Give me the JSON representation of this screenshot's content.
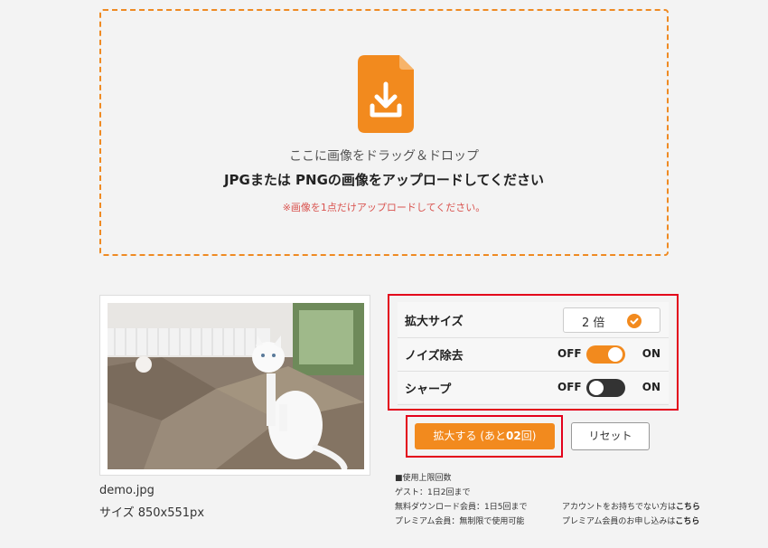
{
  "dropzone": {
    "icon": "download-file-icon",
    "drag_text": "ここに画像をドラッグ＆ドロップ",
    "upload_text": "JPGまたは PNGの画像をアップロードしてください",
    "note": "※画像を1点だけアップロードしてください。"
  },
  "preview": {
    "file_name": "demo.jpg",
    "size_text": "サイズ 850x551px"
  },
  "settings": {
    "enlarge_size": {
      "label": "拡大サイズ",
      "value": "2 倍",
      "icon": "check-circle-icon"
    },
    "noise_reduction": {
      "label": "ノイズ除去",
      "off_label": "OFF",
      "on_label": "ON",
      "state": "on"
    },
    "sharpen": {
      "label": "シャープ",
      "off_label": "OFF",
      "on_label": "ON",
      "state": "off"
    }
  },
  "actions": {
    "enlarge_prefix": "拡大する (あと",
    "enlarge_count": "02",
    "enlarge_suffix": "回)",
    "reset_label": "リセット"
  },
  "usage": {
    "title": "■使用上限回数",
    "guest": "ゲスト：1日2回まで",
    "free": "無料ダウンロード会員：1日5回まで",
    "premium": "プレミアム会員：無制限で使用可能",
    "no_account_text": "アカウントをお持ちでない方は",
    "premium_apply_text": "プレミアム会員のお申し込みは",
    "link_label": "こちら"
  },
  "colors": {
    "accent": "#f28a1e",
    "highlight_border": "#e3001b",
    "warning_text": "#d9534f"
  }
}
